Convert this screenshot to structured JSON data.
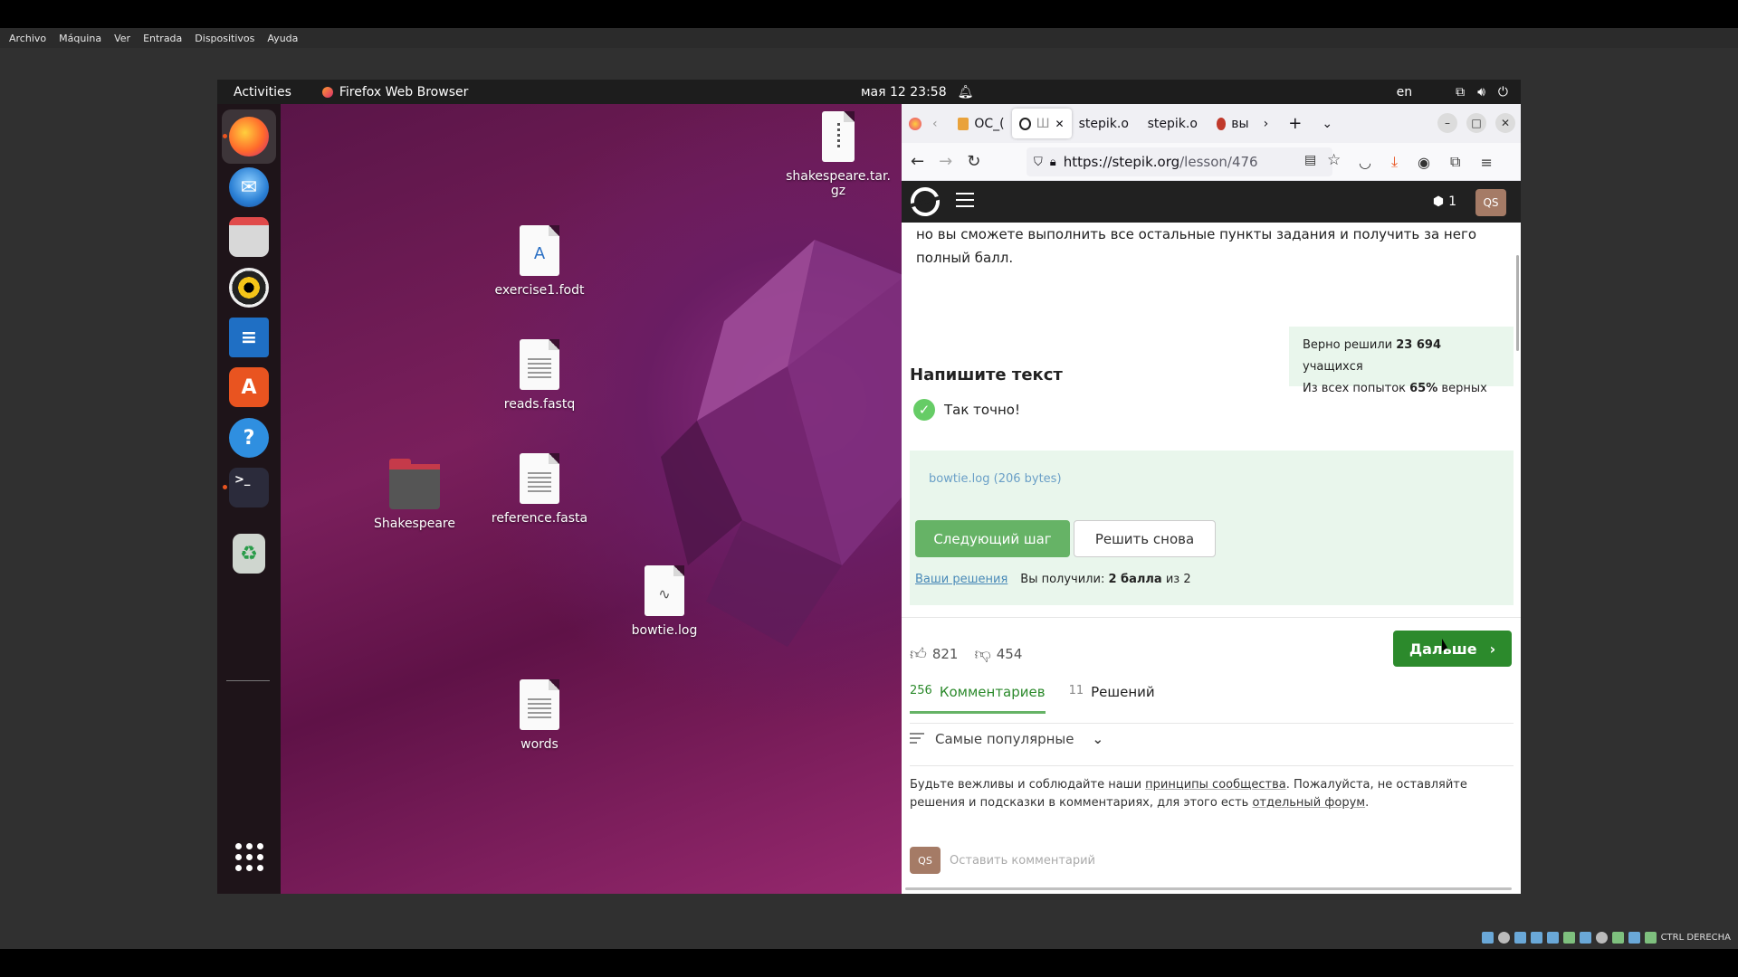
{
  "vbox": {
    "menu": [
      "Archivo",
      "Máquina",
      "Ver",
      "Entrada",
      "Dispositivos",
      "Ayuda"
    ],
    "status_label": "CTRL DERECHA"
  },
  "topbar": {
    "activities": "Activities",
    "app_name": "Firefox Web Browser",
    "datetime": "мая 12  23:58",
    "lang": "en"
  },
  "dock": {
    "items": [
      "firefox",
      "thunderbird",
      "files",
      "rhythmbox",
      "libreoffice-writer",
      "app-center",
      "help",
      "terminal",
      "trash",
      "show-apps"
    ]
  },
  "desktop": {
    "icons": {
      "shakespeare_tar": "shakespeare.tar.\ngz",
      "exercise1": "exercise1.fodt",
      "reads": "reads.fastq",
      "reference": "reference.fasta",
      "shakespeare_folder": "Shakespeare",
      "bowtie": "bowtie.log",
      "words": "words"
    }
  },
  "firefox": {
    "tabs": [
      {
        "label": "ОС_("
      },
      {
        "label": "Ш"
      },
      {
        "label": "stepik.o"
      },
      {
        "label": "stepik.o"
      },
      {
        "label": "вы"
      }
    ],
    "url_domain": "https://stepik.org",
    "url_path": "/lesson/476"
  },
  "stepik": {
    "notif_count": "1",
    "avatar_initials": "QS",
    "intro_text": "но вы сможете выполнить все остальные пункты задания и получить за него полный балл.",
    "stats": {
      "line1_prefix": "Верно решили",
      "line1_value": "23 694",
      "line1_suffix": "учащихся",
      "line2_prefix": "Из всех попыток",
      "line2_value": "65%",
      "line2_suffix": "верных"
    },
    "section_title": "Напишите текст",
    "correct_label": "Так точно!",
    "file_link": "bowtie.log (206 bytes)",
    "next_step_button": "Следующий шаг",
    "retry_button": "Решить снова",
    "your_solutions_link": "Ваши решения",
    "score_prefix": "Вы получили:",
    "score_value": "2 балла",
    "score_suffix": "из 2",
    "likes": "821",
    "dislikes": "454",
    "further_button": "Дальше",
    "tabs": [
      {
        "count": "256",
        "label": "Комментариев"
      },
      {
        "count": "11",
        "label": "Решений"
      }
    ],
    "sort_label": "Самые популярные",
    "rules": {
      "part1": "Будьте вежливы и соблюдайте наши ",
      "link1": "принципы сообщества",
      "part2": ". Пожалуйста, не оставляйте решения и подсказки в комментариях, для этого есть ",
      "link2": "отдельный форум",
      "part3": "."
    },
    "comment_avatar": "QS",
    "comment_placeholder": "Оставить комментарий"
  }
}
